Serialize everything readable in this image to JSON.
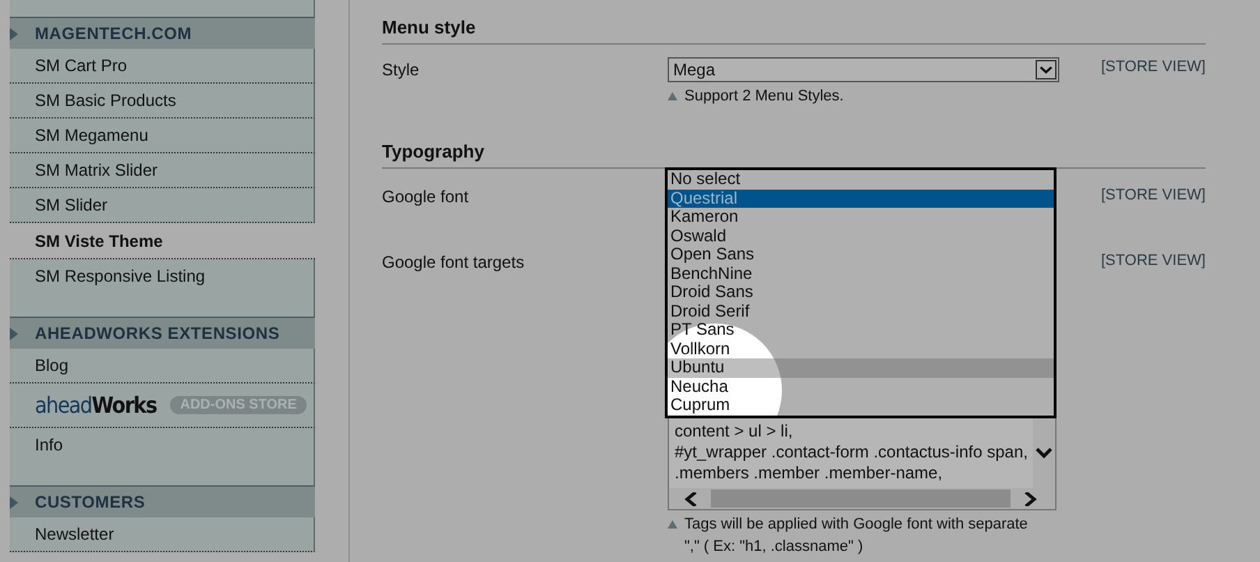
{
  "sidebar": {
    "sections": [
      {
        "title": "MAGENTECH.COM",
        "items": [
          {
            "kind": "link",
            "label": "SM Cart Pro",
            "selected": false
          },
          {
            "kind": "link",
            "label": "SM Basic Products",
            "selected": false
          },
          {
            "kind": "link",
            "label": "SM Megamenu",
            "selected": false
          },
          {
            "kind": "link",
            "label": "SM Matrix Slider",
            "selected": false
          },
          {
            "kind": "link",
            "label": "SM Slider",
            "selected": false
          },
          {
            "kind": "link",
            "label": "SM Viste Theme",
            "selected": true
          },
          {
            "kind": "link",
            "label": "SM Responsive Listing",
            "selected": false
          }
        ]
      },
      {
        "title": "AHEADWORKS EXTENSIONS",
        "items": [
          {
            "kind": "link",
            "label": "Blog",
            "selected": false
          },
          {
            "kind": "logo",
            "label": "ahead",
            "label_2": "Works",
            "badge": "ADD-ONS STORE",
            "selected": false
          },
          {
            "kind": "link",
            "label": "Info",
            "selected": false
          }
        ]
      },
      {
        "title": "CUSTOMERS",
        "items": [
          {
            "kind": "link",
            "label": "Newsletter",
            "selected": false
          }
        ]
      }
    ]
  },
  "sections": [
    {
      "title": "Menu style",
      "fields": [
        {
          "kind": "select",
          "label": "Style",
          "value": "Mega",
          "scope": "[STORE VIEW]",
          "note": "Support 2 Menu Styles."
        }
      ]
    },
    {
      "title": "Typography",
      "fields": [
        {
          "kind": "open_select",
          "label": "Google font",
          "scope": "[STORE VIEW]",
          "options": [
            {
              "label": "No select",
              "selected": false,
              "hovered": false
            },
            {
              "label": "Questrial",
              "selected": true,
              "hovered": false
            },
            {
              "label": "Kameron",
              "selected": false,
              "hovered": false
            },
            {
              "label": "Oswald",
              "selected": false,
              "hovered": false
            },
            {
              "label": "Open Sans",
              "selected": false,
              "hovered": false
            },
            {
              "label": "BenchNine",
              "selected": false,
              "hovered": false
            },
            {
              "label": "Droid Sans",
              "selected": false,
              "hovered": false
            },
            {
              "label": "Droid Serif",
              "selected": false,
              "hovered": false
            },
            {
              "label": "PT Sans",
              "selected": false,
              "hovered": false
            },
            {
              "label": "Vollkorn",
              "selected": false,
              "hovered": false
            },
            {
              "label": "Ubuntu",
              "selected": false,
              "hovered": true
            },
            {
              "label": "Neucha",
              "selected": false,
              "hovered": false
            },
            {
              "label": "Cuprum",
              "selected": false,
              "hovered": false
            }
          ]
        },
        {
          "kind": "textarea",
          "label": "Google font targets",
          "scope": "[STORE VIEW]",
          "lines": [
            "content > ul > li,",
            "#yt_wrapper .contact-form .contactus-info span,",
            ".members .member .member-name,"
          ],
          "note": "Tags will be applied with Google font with separate",
          "note_2": "\",\" ( Ex: \"h1, .classname\" )"
        }
      ]
    }
  ]
}
